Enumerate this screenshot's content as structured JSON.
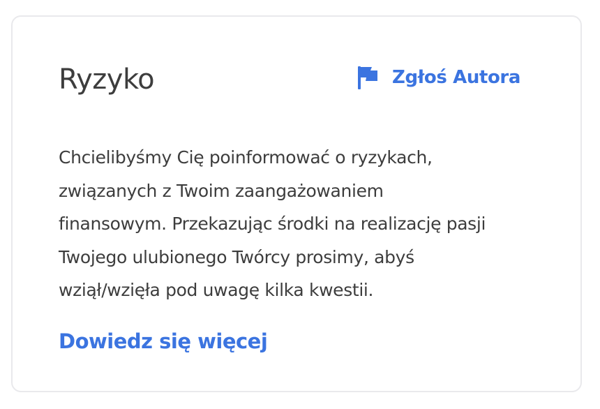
{
  "card": {
    "title": "Ryzyko",
    "report_link": {
      "icon": "flag-icon",
      "label": "Zgłoś Autora"
    },
    "body": "Chcielibyśmy Cię poinformować o ryzykach,\nzwiązanych z Twoim zaangażowaniem\nfinansowym. Przekazując środki na realizację pasji\nTwojego ulubionego Twórcy prosimy, abyś\nwziął/wzięła pod uwagę kilka kwestii.",
    "learn_more_label": "Dowiedz się więcej"
  },
  "colors": {
    "accent": "#3b74e0",
    "text": "#3d3d3d",
    "border": "#e9e9ec",
    "background": "#ffffff"
  }
}
